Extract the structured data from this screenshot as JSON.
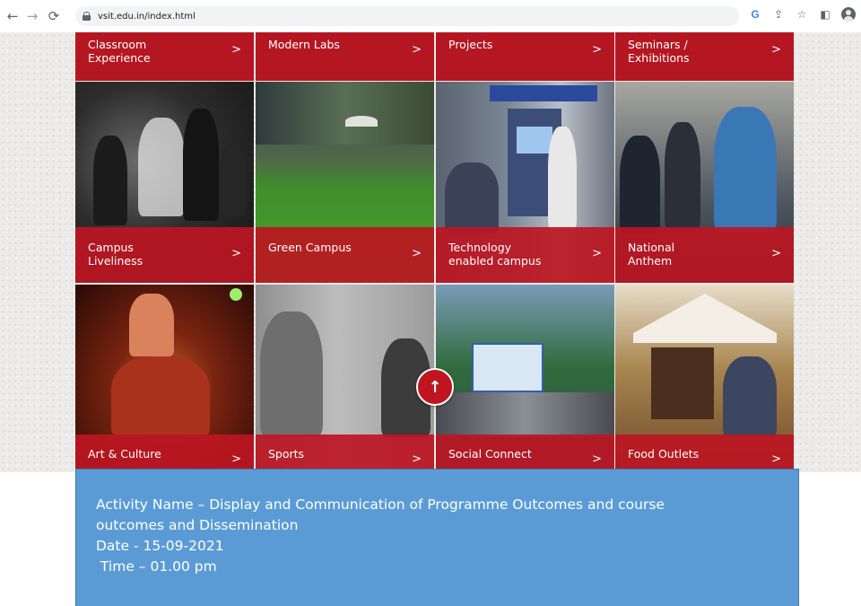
{
  "browser": {
    "url": "vsit.edu.in/index.html",
    "icons": [
      "back-icon",
      "forward-icon",
      "reload-icon",
      "lock-icon",
      "google-icon",
      "share-icon",
      "star-icon",
      "sidebar-icon",
      "profile-icon"
    ]
  },
  "tiles": {
    "row1": [
      {
        "label": "Classroom\nExperience",
        "arrow": ">"
      },
      {
        "label": "Modern Labs",
        "arrow": ">"
      },
      {
        "label": "Projects",
        "arrow": ">"
      },
      {
        "label": "Seminars /\nExhibitions",
        "arrow": ">"
      }
    ],
    "row2": [
      {
        "label": "Campus\nLiveliness",
        "arrow": ">"
      },
      {
        "label": "Green Campus",
        "arrow": ">"
      },
      {
        "label": "Technology\nenabled campus",
        "arrow": ">"
      },
      {
        "label": "National\nAnthem",
        "arrow": ">"
      }
    ],
    "row3": [
      {
        "label": "Art & Culture",
        "arrow": ">"
      },
      {
        "label": "Sports",
        "arrow": ">"
      },
      {
        "label": "Social Connect",
        "arrow": ">"
      },
      {
        "label": "Food Outlets",
        "arrow": ">"
      }
    ]
  },
  "scroll_top": {
    "glyph": "↑"
  },
  "info": {
    "line1": "Activity Name – Display and Communication of Programme Outcomes and course",
    "line2": "outcomes and Dissemination",
    "line3": "Date - 15-09-2021",
    "line4": " Time – 01.00 pm"
  },
  "colors": {
    "tile_label_red": "#bc1622",
    "info_blue": "#5b9bd5"
  }
}
